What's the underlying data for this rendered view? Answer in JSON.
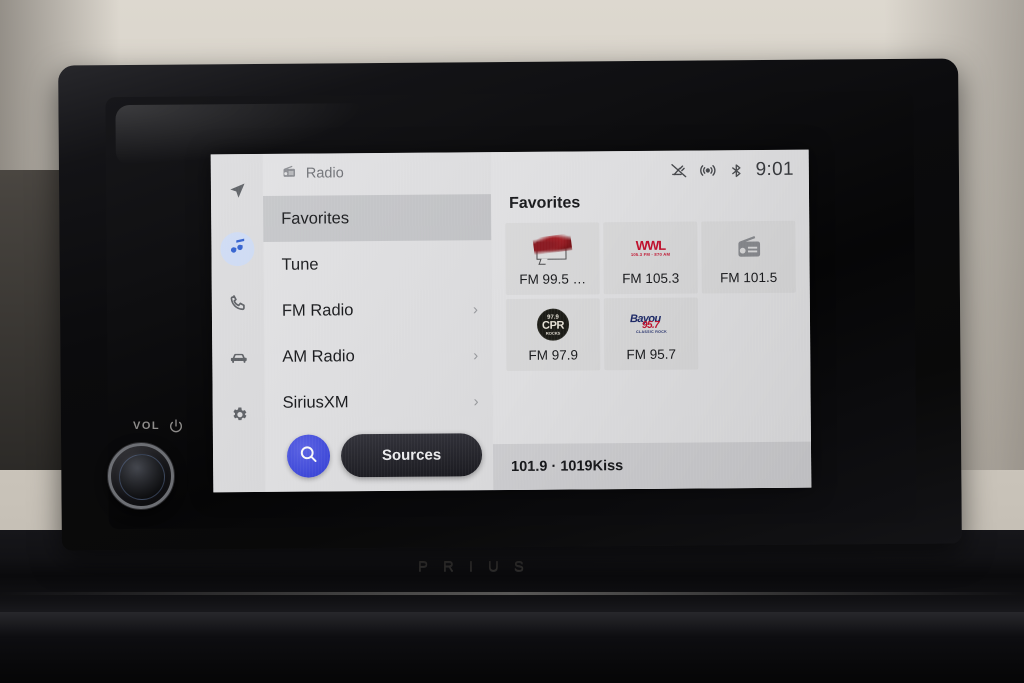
{
  "vehicle": {
    "badge": "PRIUS",
    "volume_label": "VOL",
    "volume_icon": "power-icon",
    "knob_name": "volume-knob"
  },
  "nav_rail": {
    "items": [
      {
        "icon": "navigation-arrow-icon",
        "name": "navigation",
        "active": false
      },
      {
        "icon": "music-note-icon",
        "name": "media",
        "active": true
      },
      {
        "icon": "phone-icon",
        "name": "phone",
        "active": false
      },
      {
        "icon": "car-icon",
        "name": "vehicle",
        "active": false
      },
      {
        "icon": "gear-icon",
        "name": "settings",
        "active": false
      }
    ],
    "active_color": "#cfdcf5",
    "active_icon_color": "#2f5fd0"
  },
  "menu": {
    "header": {
      "icon": "radio-icon",
      "label": "Radio"
    },
    "items": [
      {
        "label": "Favorites",
        "selected": true,
        "chevron": false
      },
      {
        "label": "Tune",
        "selected": false,
        "chevron": false
      },
      {
        "label": "FM Radio",
        "selected": false,
        "chevron": true
      },
      {
        "label": "AM Radio",
        "selected": false,
        "chevron": true
      },
      {
        "label": "SiriusXM",
        "selected": false,
        "chevron": true
      }
    ],
    "chevron_glyph": "›"
  },
  "bottom_controls": {
    "search_icon": "search-icon",
    "sources_label": "Sources",
    "search_color": "#3d48dd"
  },
  "statusbar": {
    "icons": [
      "satellite-off-icon",
      "broadcast-icon",
      "bluetooth-icon"
    ],
    "time": "9:01"
  },
  "content": {
    "title": "Favorites",
    "favorites": [
      {
        "label": "FM 99.5 …",
        "logo": "logo-995",
        "has_logo": true
      },
      {
        "label": "FM 105.3",
        "logo": "logo-wwl",
        "has_logo": true
      },
      {
        "label": "FM 101.5",
        "logo": "logo-radio",
        "has_logo": true
      },
      {
        "label": "FM 97.9",
        "logo": "logo-cpr",
        "has_logo": true
      },
      {
        "label": "FM 95.7",
        "logo": "logo-bayou",
        "has_logo": true
      }
    ],
    "logo_text": {
      "wwl_main": "WWL",
      "wwl_sub": "105.3 FM · 870 AM",
      "cpr_top": "97.9",
      "cpr_mid": "CPR",
      "cpr_bottom": "ROCKS",
      "bayou_top": "Bayou",
      "bayou_mid": "95.7",
      "bayou_bottom": "CLASSIC ROCK"
    },
    "now_playing": "101.9 · 1019Kiss"
  }
}
